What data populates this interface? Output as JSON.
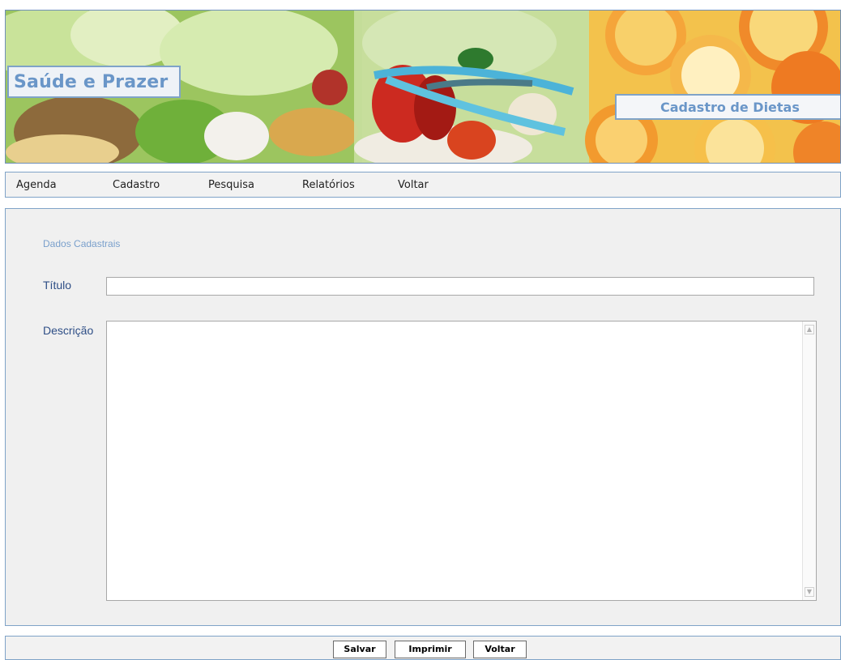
{
  "header": {
    "brand": "Saúde e Prazer",
    "page_title": "Cadastro de Dietas"
  },
  "menu": {
    "items": [
      "Agenda",
      "Cadastro",
      "Pesquisa",
      "Relatórios",
      "Voltar"
    ]
  },
  "form": {
    "section_title": "Dados Cadastrais",
    "title_label": "Título",
    "title_value": "",
    "description_label": "Descrição",
    "description_value": ""
  },
  "footer": {
    "save_label": "Salvar",
    "print_label": "Imprimir",
    "back_label": "Voltar"
  },
  "colors": {
    "accent_blue": "#6a96c8",
    "border_blue": "#7fa3c8",
    "label_blue": "#2e4e86"
  },
  "icons": {
    "scroll_up": "scroll-up-arrow-icon",
    "scroll_down": "scroll-down-arrow-icon"
  }
}
